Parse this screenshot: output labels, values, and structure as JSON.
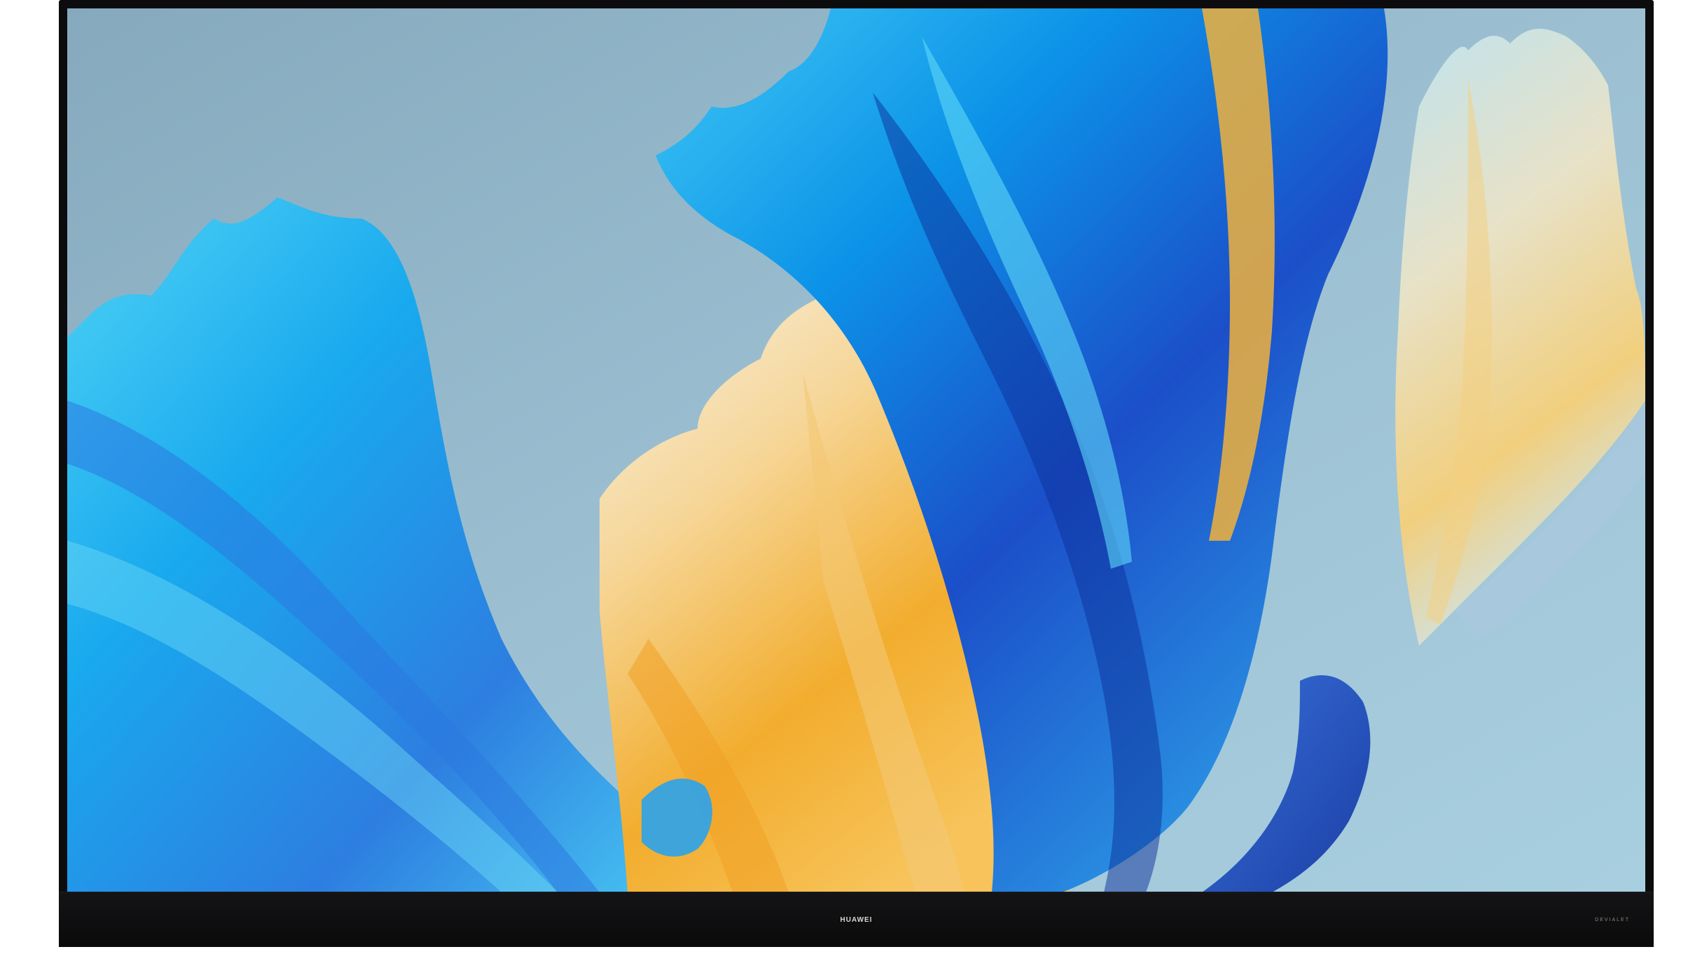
{
  "device": {
    "brand_logo": "HUAWEI",
    "audio_logo": "DEVIALET"
  },
  "wallpaper": {
    "description_icon": "abstract-feather-wallpaper",
    "colors": {
      "sky": "#93b6c8",
      "cyan": "#1fb8ef",
      "blue": "#1b5fd0",
      "gold": "#f2b54a",
      "cream": "#f4ecd6",
      "bezel": "#0c0c0e"
    }
  }
}
